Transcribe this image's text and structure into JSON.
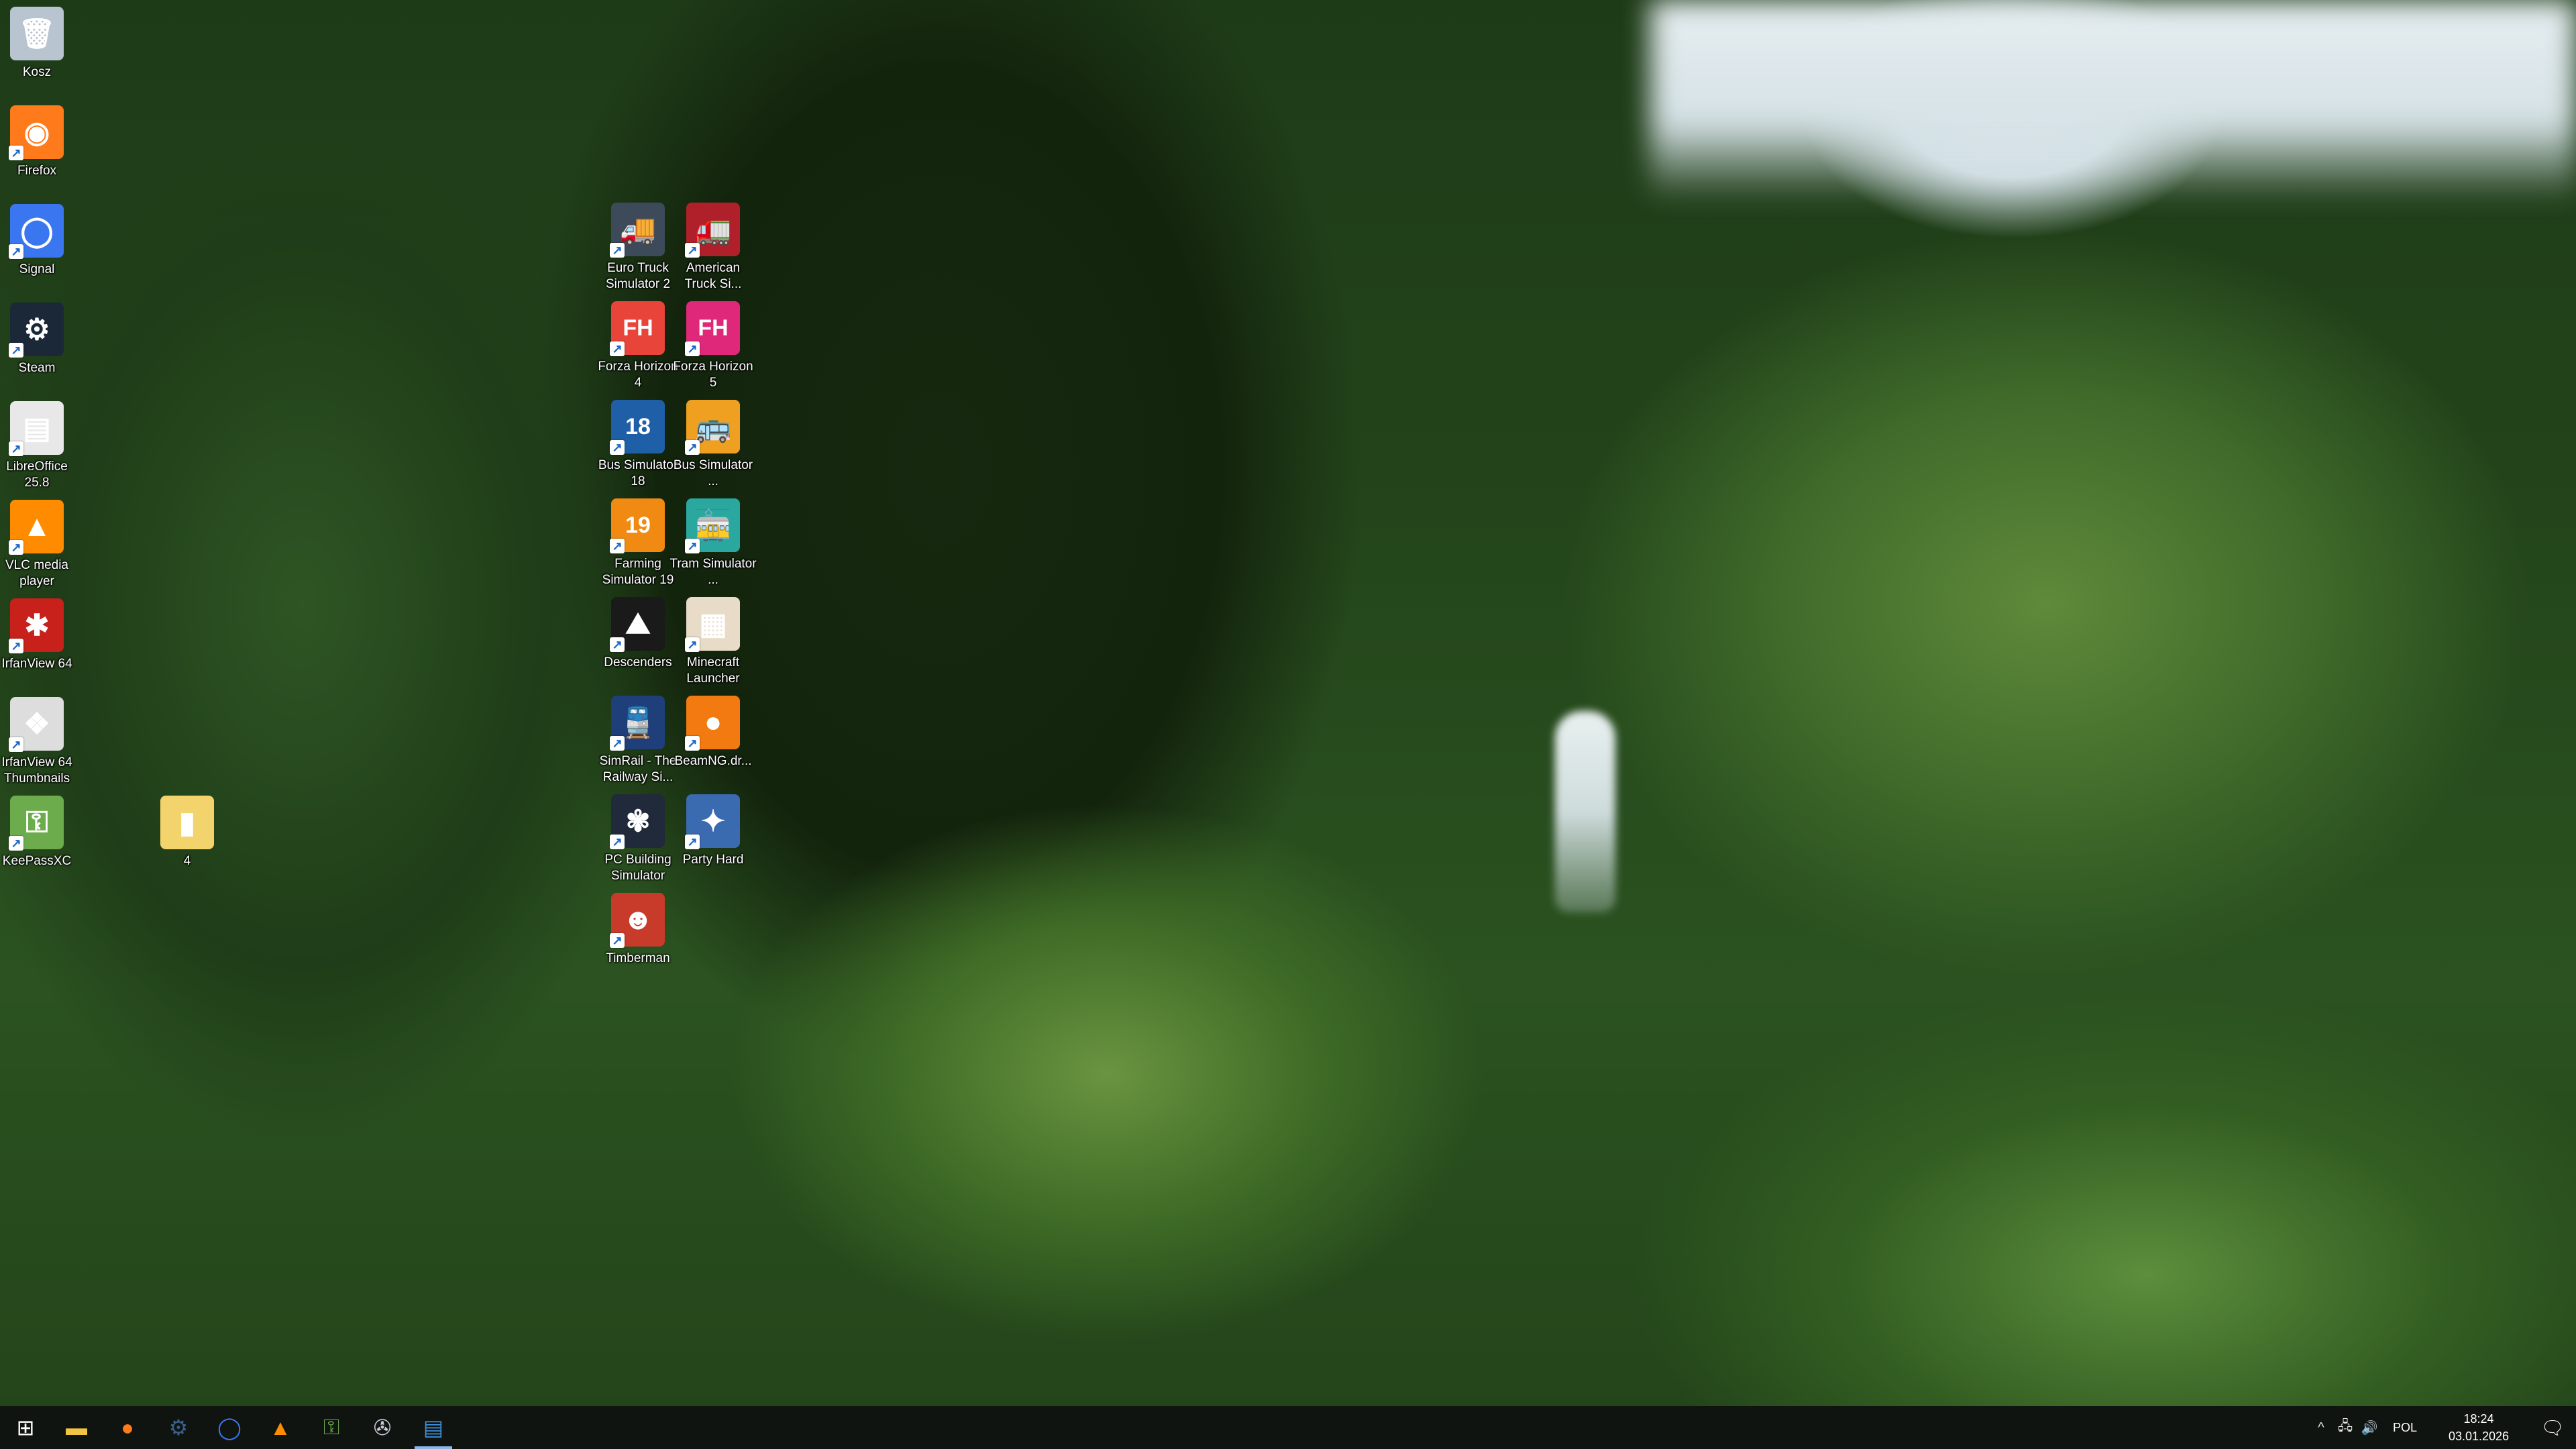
{
  "desktop": {
    "left_column": [
      {
        "label": "Kosz",
        "icon": "recycle-bin-icon",
        "color": "#b8c4d0",
        "glyph": "🗑",
        "shortcut": false
      },
      {
        "label": "Firefox",
        "icon": "firefox-icon",
        "color": "#ff7a1a",
        "glyph": "◉",
        "shortcut": true
      },
      {
        "label": "Signal",
        "icon": "signal-icon",
        "color": "#3a76f0",
        "glyph": "◯",
        "shortcut": true
      },
      {
        "label": "Steam",
        "icon": "steam-icon",
        "color": "#1b2838",
        "glyph": "⚙",
        "shortcut": true
      },
      {
        "label": "LibreOffice 25.8",
        "icon": "libreoffice-icon",
        "color": "#e8e8e8",
        "glyph": "▤",
        "shortcut": true
      },
      {
        "label": "VLC media player",
        "icon": "vlc-icon",
        "color": "#ff8c00",
        "glyph": "▲",
        "shortcut": true
      },
      {
        "label": "IrfanView 64",
        "icon": "irfanview-icon",
        "color": "#c8201a",
        "glyph": "✱",
        "shortcut": true
      },
      {
        "label": "IrfanView 64 Thumbnails",
        "icon": "irfanview-thumbnails-icon",
        "color": "#dddddd",
        "glyph": "❖",
        "shortcut": true
      },
      {
        "label": "KeePassXC",
        "icon": "keepassxc-icon",
        "color": "#6cac4d",
        "glyph": "⚿",
        "shortcut": true
      }
    ],
    "folder": {
      "label": "4",
      "icon": "folder-icon",
      "color": "#f3d36b",
      "glyph": "▮"
    },
    "games_col1": [
      {
        "label": "Euro Truck Simulator 2",
        "icon": "euro-truck-simulator-2-icon",
        "color": "#3c4a5a",
        "glyph": "🚚"
      },
      {
        "label": "Forza Horizon 4",
        "icon": "forza-horizon-4-icon",
        "color": "#e8443a",
        "glyph": "FH"
      },
      {
        "label": "Bus Simulator 18",
        "icon": "bus-simulator-18-icon",
        "color": "#1f5fa8",
        "glyph": "18"
      },
      {
        "label": "Farming Simulator 19",
        "icon": "farming-simulator-19-icon",
        "color": "#f08a12",
        "glyph": "19"
      },
      {
        "label": "Descenders",
        "icon": "descenders-icon",
        "color": "#1a1a1a",
        "glyph": "⛰"
      },
      {
        "label": "SimRail - The Railway Si...",
        "icon": "simrail-icon",
        "color": "#1e3f7a",
        "glyph": "🚆"
      },
      {
        "label": "PC Building Simulator",
        "icon": "pc-building-simulator-icon",
        "color": "#202a3a",
        "glyph": "✾"
      },
      {
        "label": "Timberman",
        "icon": "timberman-icon",
        "color": "#c83a2a",
        "glyph": "☻"
      }
    ],
    "games_col2": [
      {
        "label": "American Truck Si...",
        "icon": "american-truck-simulator-icon",
        "color": "#b0202a",
        "glyph": "🚛"
      },
      {
        "label": "Forza Horizon 5",
        "icon": "forza-horizon-5-icon",
        "color": "#e0287a",
        "glyph": "FH"
      },
      {
        "label": "Bus Simulator ...",
        "icon": "bus-simulator-icon",
        "color": "#f0a020",
        "glyph": "🚌"
      },
      {
        "label": "Tram Simulator ...",
        "icon": "tram-simulator-icon",
        "color": "#2aa8a0",
        "glyph": "🚋"
      },
      {
        "label": "Minecraft Launcher",
        "icon": "minecraft-launcher-icon",
        "color": "#e8dcc8",
        "glyph": "▦"
      },
      {
        "label": "BeamNG.dr...",
        "icon": "beamng-icon",
        "color": "#f27a10",
        "glyph": "●"
      },
      {
        "label": "Party Hard",
        "icon": "party-hard-icon",
        "color": "#3a6ab0",
        "glyph": "✦"
      }
    ]
  },
  "taskbar": {
    "buttons": [
      {
        "name": "start-button",
        "icon": "windows-start-icon",
        "color": "#ffffff",
        "glyph": "⊞",
        "active": false
      },
      {
        "name": "taskbar-file-explorer",
        "icon": "file-explorer-icon",
        "color": "#f3c443",
        "glyph": "▬",
        "active": false
      },
      {
        "name": "taskbar-firefox",
        "icon": "firefox-icon",
        "color": "#ff7a1a",
        "glyph": "●",
        "active": false
      },
      {
        "name": "taskbar-steam",
        "icon": "steam-icon",
        "color": "#3a5f8a",
        "glyph": "⚙",
        "active": false
      },
      {
        "name": "taskbar-signal",
        "icon": "signal-icon",
        "color": "#3a76f0",
        "glyph": "◯",
        "active": false
      },
      {
        "name": "taskbar-vlc",
        "icon": "vlc-icon",
        "color": "#ff8c00",
        "glyph": "▲",
        "active": false
      },
      {
        "name": "taskbar-keepassxc",
        "icon": "keepassxc-icon",
        "color": "#6cac4d",
        "glyph": "⚿",
        "active": false
      },
      {
        "name": "taskbar-app",
        "icon": "app-icon",
        "color": "#c8c8d8",
        "glyph": "✇",
        "active": false
      },
      {
        "name": "taskbar-notepad",
        "icon": "notepad-icon",
        "color": "#3b8fd9",
        "glyph": "▤",
        "active": true
      }
    ],
    "tray": {
      "chevron": "^",
      "language": "POL",
      "time": "18:24",
      "date": "03.01.2026"
    }
  }
}
